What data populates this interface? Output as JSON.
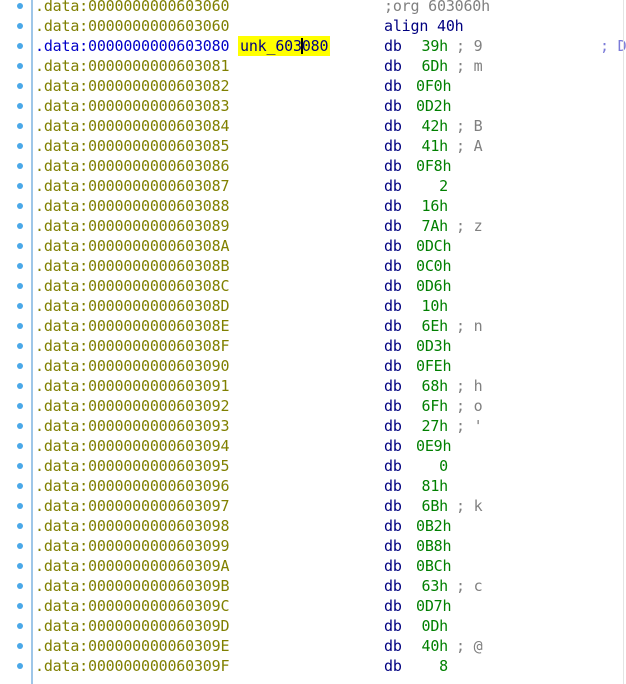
{
  "rows": [
    {
      "seg": ".data",
      "addr": "0000000000603060",
      "mnem": ";org 603060h",
      "operand": "",
      "comment": "",
      "label": "",
      "xref": "",
      "dim": true,
      "current": false
    },
    {
      "seg": ".data",
      "addr": "0000000000603060",
      "mnem": "align 40h",
      "operand": "",
      "comment": "",
      "label": "",
      "xref": "",
      "dim": false,
      "current": false
    },
    {
      "seg": ".data",
      "addr": "0000000000603080",
      "mnem": "db",
      "operand": "39h",
      "comment": "; 9",
      "label": "unk_603080",
      "xref": "; D",
      "dim": false,
      "current": true
    },
    {
      "seg": ".data",
      "addr": "0000000000603081",
      "mnem": "db",
      "operand": "6Dh",
      "comment": "; m",
      "label": "",
      "xref": "",
      "dim": false,
      "current": false
    },
    {
      "seg": ".data",
      "addr": "0000000000603082",
      "mnem": "db",
      "operand": "0F0h",
      "comment": "",
      "label": "",
      "xref": "",
      "dim": false,
      "current": false
    },
    {
      "seg": ".data",
      "addr": "0000000000603083",
      "mnem": "db",
      "operand": "0D2h",
      "comment": "",
      "label": "",
      "xref": "",
      "dim": false,
      "current": false
    },
    {
      "seg": ".data",
      "addr": "0000000000603084",
      "mnem": "db",
      "operand": "42h",
      "comment": "; B",
      "label": "",
      "xref": "",
      "dim": false,
      "current": false
    },
    {
      "seg": ".data",
      "addr": "0000000000603085",
      "mnem": "db",
      "operand": "41h",
      "comment": "; A",
      "label": "",
      "xref": "",
      "dim": false,
      "current": false
    },
    {
      "seg": ".data",
      "addr": "0000000000603086",
      "mnem": "db",
      "operand": "0F8h",
      "comment": "",
      "label": "",
      "xref": "",
      "dim": false,
      "current": false
    },
    {
      "seg": ".data",
      "addr": "0000000000603087",
      "mnem": "db",
      "operand": "2",
      "comment": "",
      "label": "",
      "xref": "",
      "dim": false,
      "current": false
    },
    {
      "seg": ".data",
      "addr": "0000000000603088",
      "mnem": "db",
      "operand": "16h",
      "comment": "",
      "label": "",
      "xref": "",
      "dim": false,
      "current": false
    },
    {
      "seg": ".data",
      "addr": "0000000000603089",
      "mnem": "db",
      "operand": "7Ah",
      "comment": "; z",
      "label": "",
      "xref": "",
      "dim": false,
      "current": false
    },
    {
      "seg": ".data",
      "addr": "000000000060308A",
      "mnem": "db",
      "operand": "0DCh",
      "comment": "",
      "label": "",
      "xref": "",
      "dim": false,
      "current": false
    },
    {
      "seg": ".data",
      "addr": "000000000060308B",
      "mnem": "db",
      "operand": "0C0h",
      "comment": "",
      "label": "",
      "xref": "",
      "dim": false,
      "current": false
    },
    {
      "seg": ".data",
      "addr": "000000000060308C",
      "mnem": "db",
      "operand": "0D6h",
      "comment": "",
      "label": "",
      "xref": "",
      "dim": false,
      "current": false
    },
    {
      "seg": ".data",
      "addr": "000000000060308D",
      "mnem": "db",
      "operand": "10h",
      "comment": "",
      "label": "",
      "xref": "",
      "dim": false,
      "current": false
    },
    {
      "seg": ".data",
      "addr": "000000000060308E",
      "mnem": "db",
      "operand": "6Eh",
      "comment": "; n",
      "label": "",
      "xref": "",
      "dim": false,
      "current": false
    },
    {
      "seg": ".data",
      "addr": "000000000060308F",
      "mnem": "db",
      "operand": "0D3h",
      "comment": "",
      "label": "",
      "xref": "",
      "dim": false,
      "current": false
    },
    {
      "seg": ".data",
      "addr": "0000000000603090",
      "mnem": "db",
      "operand": "0FEh",
      "comment": "",
      "label": "",
      "xref": "",
      "dim": false,
      "current": false
    },
    {
      "seg": ".data",
      "addr": "0000000000603091",
      "mnem": "db",
      "operand": "68h",
      "comment": "; h",
      "label": "",
      "xref": "",
      "dim": false,
      "current": false
    },
    {
      "seg": ".data",
      "addr": "0000000000603092",
      "mnem": "db",
      "operand": "6Fh",
      "comment": "; o",
      "label": "",
      "xref": "",
      "dim": false,
      "current": false
    },
    {
      "seg": ".data",
      "addr": "0000000000603093",
      "mnem": "db",
      "operand": "27h",
      "comment": "; '",
      "label": "",
      "xref": "",
      "dim": false,
      "current": false
    },
    {
      "seg": ".data",
      "addr": "0000000000603094",
      "mnem": "db",
      "operand": "0E9h",
      "comment": "",
      "label": "",
      "xref": "",
      "dim": false,
      "current": false
    },
    {
      "seg": ".data",
      "addr": "0000000000603095",
      "mnem": "db",
      "operand": "0",
      "comment": "",
      "label": "",
      "xref": "",
      "dim": false,
      "current": false
    },
    {
      "seg": ".data",
      "addr": "0000000000603096",
      "mnem": "db",
      "operand": "81h",
      "comment": "",
      "label": "",
      "xref": "",
      "dim": false,
      "current": false
    },
    {
      "seg": ".data",
      "addr": "0000000000603097",
      "mnem": "db",
      "operand": "6Bh",
      "comment": "; k",
      "label": "",
      "xref": "",
      "dim": false,
      "current": false
    },
    {
      "seg": ".data",
      "addr": "0000000000603098",
      "mnem": "db",
      "operand": "0B2h",
      "comment": "",
      "label": "",
      "xref": "",
      "dim": false,
      "current": false
    },
    {
      "seg": ".data",
      "addr": "0000000000603099",
      "mnem": "db",
      "operand": "0B8h",
      "comment": "",
      "label": "",
      "xref": "",
      "dim": false,
      "current": false
    },
    {
      "seg": ".data",
      "addr": "000000000060309A",
      "mnem": "db",
      "operand": "0BCh",
      "comment": "",
      "label": "",
      "xref": "",
      "dim": false,
      "current": false
    },
    {
      "seg": ".data",
      "addr": "000000000060309B",
      "mnem": "db",
      "operand": "63h",
      "comment": "; c",
      "label": "",
      "xref": "",
      "dim": false,
      "current": false
    },
    {
      "seg": ".data",
      "addr": "000000000060309C",
      "mnem": "db",
      "operand": "0D7h",
      "comment": "",
      "label": "",
      "xref": "",
      "dim": false,
      "current": false
    },
    {
      "seg": ".data",
      "addr": "000000000060309D",
      "mnem": "db",
      "operand": "0Dh",
      "comment": "",
      "label": "",
      "xref": "",
      "dim": false,
      "current": false
    },
    {
      "seg": ".data",
      "addr": "000000000060309E",
      "mnem": "db",
      "operand": "40h",
      "comment": "; @",
      "label": "",
      "xref": "",
      "dim": false,
      "current": false
    },
    {
      "seg": ".data",
      "addr": "000000000060309F",
      "mnem": "db",
      "operand": "8",
      "comment": "",
      "label": "",
      "xref": "",
      "dim": false,
      "current": false
    }
  ],
  "cursor": {
    "label_before": "unk_603",
    "label_after": "080"
  },
  "colors": {
    "segment_address": "#808000",
    "current_address": "#0000c8",
    "mnemonic": "#000080",
    "operand": "#008000",
    "comment": "#808080",
    "label_highlight": "#ffff00",
    "gutter_marker": "#4aa8e8"
  }
}
